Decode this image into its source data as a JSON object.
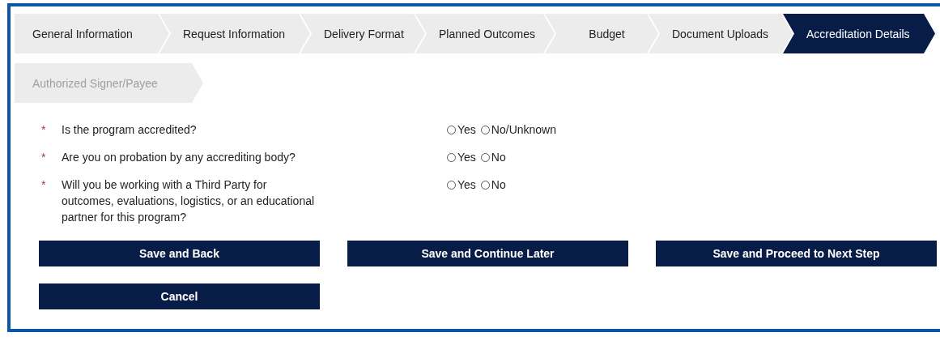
{
  "steps": [
    {
      "label": "General Information",
      "selected": false,
      "disabled": false
    },
    {
      "label": "Request Information",
      "selected": false,
      "disabled": false
    },
    {
      "label": "Delivery Format",
      "selected": false,
      "disabled": false
    },
    {
      "label": "Planned Outcomes",
      "selected": false,
      "disabled": false
    },
    {
      "label": "Budget",
      "selected": false,
      "disabled": false
    },
    {
      "label": "Document Uploads",
      "selected": false,
      "disabled": false
    },
    {
      "label": "Accreditation Details",
      "selected": true,
      "disabled": false
    },
    {
      "label": "Authorized Signer/Payee",
      "selected": false,
      "disabled": true
    }
  ],
  "questions": [
    {
      "required_mark": "*",
      "text": "Is the program accredited?",
      "options": [
        {
          "label": "Yes",
          "selected": false
        },
        {
          "label": "No/Unknown",
          "selected": false
        }
      ]
    },
    {
      "required_mark": "*",
      "text": "Are you on probation by any accrediting body?",
      "options": [
        {
          "label": "Yes",
          "selected": false
        },
        {
          "label": "No",
          "selected": false
        }
      ]
    },
    {
      "required_mark": "*",
      "text": "Will you be working with a Third Party for outcomes, evaluations, logistics, or an educational partner for this program?",
      "options": [
        {
          "label": "Yes",
          "selected": false
        },
        {
          "label": "No",
          "selected": false
        }
      ]
    }
  ],
  "buttons": [
    "Save and Back",
    "Save and Continue Later",
    "Save and Proceed to Next Step",
    "Cancel"
  ]
}
